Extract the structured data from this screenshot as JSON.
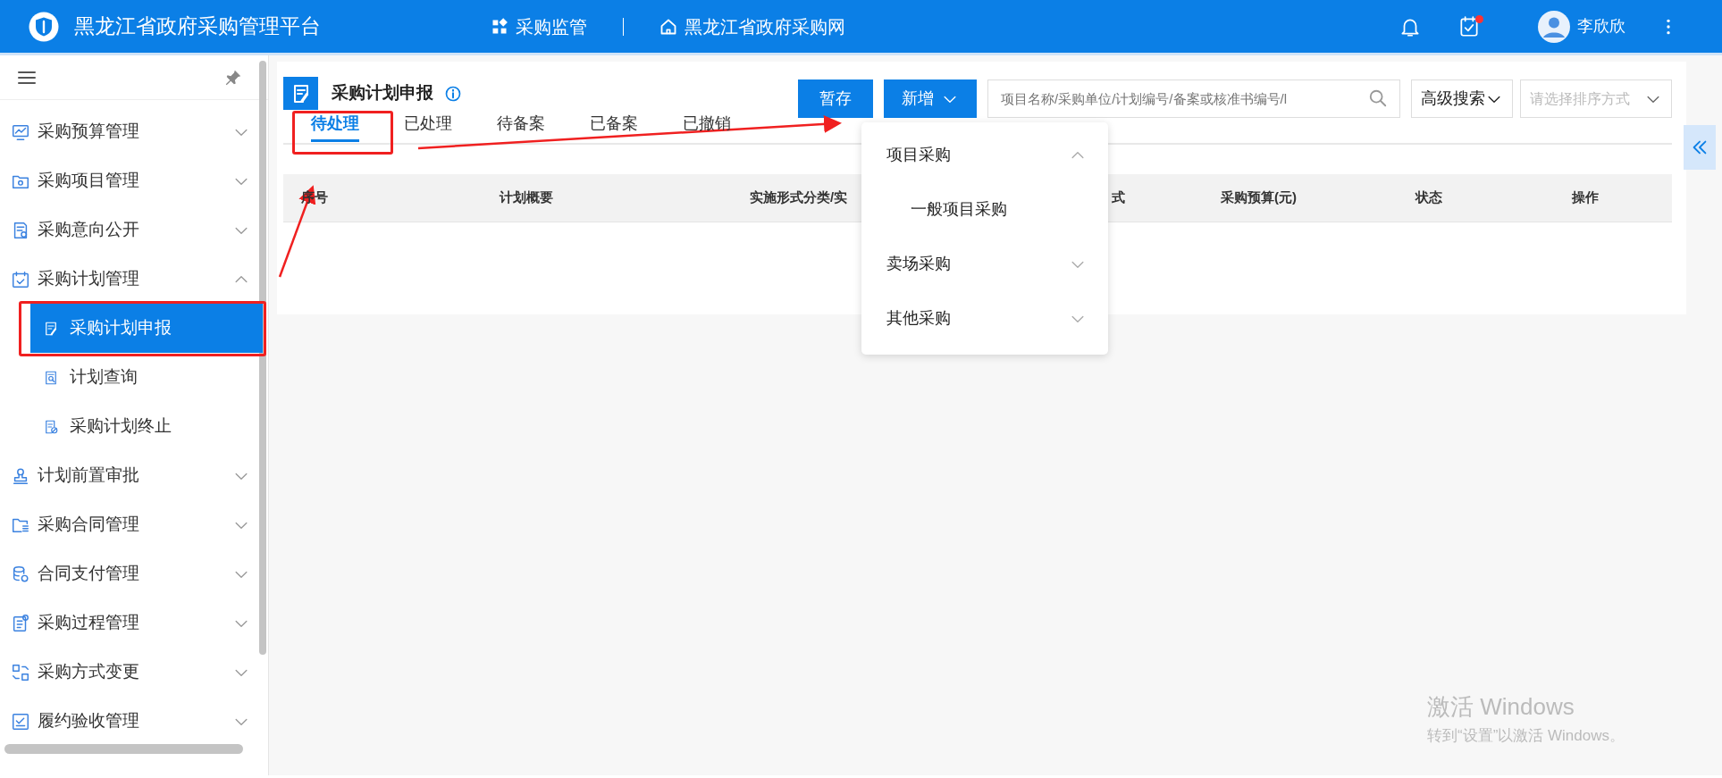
{
  "header": {
    "title": "黑龙江省政府采购管理平台",
    "nav": [
      {
        "label": "采购监管"
      },
      {
        "label": "黑龙江省政府采购网"
      }
    ],
    "notifications": {
      "unread": false
    },
    "tasks": {
      "unread": true
    },
    "user": {
      "name": "李欣欣"
    }
  },
  "sidebar": {
    "items": [
      {
        "label": "采购预算管理",
        "expanded": false,
        "selected": false
      },
      {
        "label": "采购项目管理",
        "expanded": false,
        "selected": false
      },
      {
        "label": "采购意向公开",
        "expanded": false,
        "selected": false
      },
      {
        "label": "采购计划管理",
        "expanded": true,
        "selected": false,
        "children": [
          {
            "label": "采购计划申报",
            "selected": true
          },
          {
            "label": "计划查询",
            "selected": false
          },
          {
            "label": "采购计划终止",
            "selected": false
          }
        ]
      },
      {
        "label": "计划前置审批",
        "expanded": false,
        "selected": false
      },
      {
        "label": "采购合同管理",
        "expanded": false,
        "selected": false
      },
      {
        "label": "合同支付管理",
        "expanded": false,
        "selected": false
      },
      {
        "label": "采购过程管理",
        "expanded": false,
        "selected": false
      },
      {
        "label": "采购方式变更",
        "expanded": false,
        "selected": false
      },
      {
        "label": "履约验收管理",
        "expanded": false,
        "selected": false
      }
    ]
  },
  "page": {
    "title": "采购计划申报",
    "buttons": [
      {
        "label": "暂存",
        "kind": "plain"
      },
      {
        "label": "新增",
        "kind": "menu"
      }
    ],
    "search": {
      "placeholder": "项目名称/采购单位/计划编号/备案或核准书编号/l"
    },
    "advanced_search": {
      "label": "高级搜索"
    },
    "sort": {
      "placeholder": "请选择排序方式"
    },
    "tabs": [
      {
        "label": "待处理",
        "selected": true
      },
      {
        "label": "已处理",
        "selected": false
      },
      {
        "label": "待备案",
        "selected": false
      },
      {
        "label": "已备案",
        "selected": false
      },
      {
        "label": "已撤销",
        "selected": false
      }
    ],
    "table": {
      "columns": [
        "序号",
        "计划概要",
        "实施形式分类/实",
        "式",
        "采购预算(元)",
        "状态",
        "操作"
      ]
    },
    "new_menu": {
      "items": [
        {
          "label": "项目采购",
          "expanded": true,
          "children": [
            {
              "label": "一般项目采购"
            }
          ]
        },
        {
          "label": "卖场采购",
          "expanded": false
        },
        {
          "label": "其他采购",
          "expanded": false
        }
      ]
    }
  },
  "os_overlay": {
    "title": "激活 Windows",
    "subtitle": "转到“设置”以激活 Windows。"
  }
}
